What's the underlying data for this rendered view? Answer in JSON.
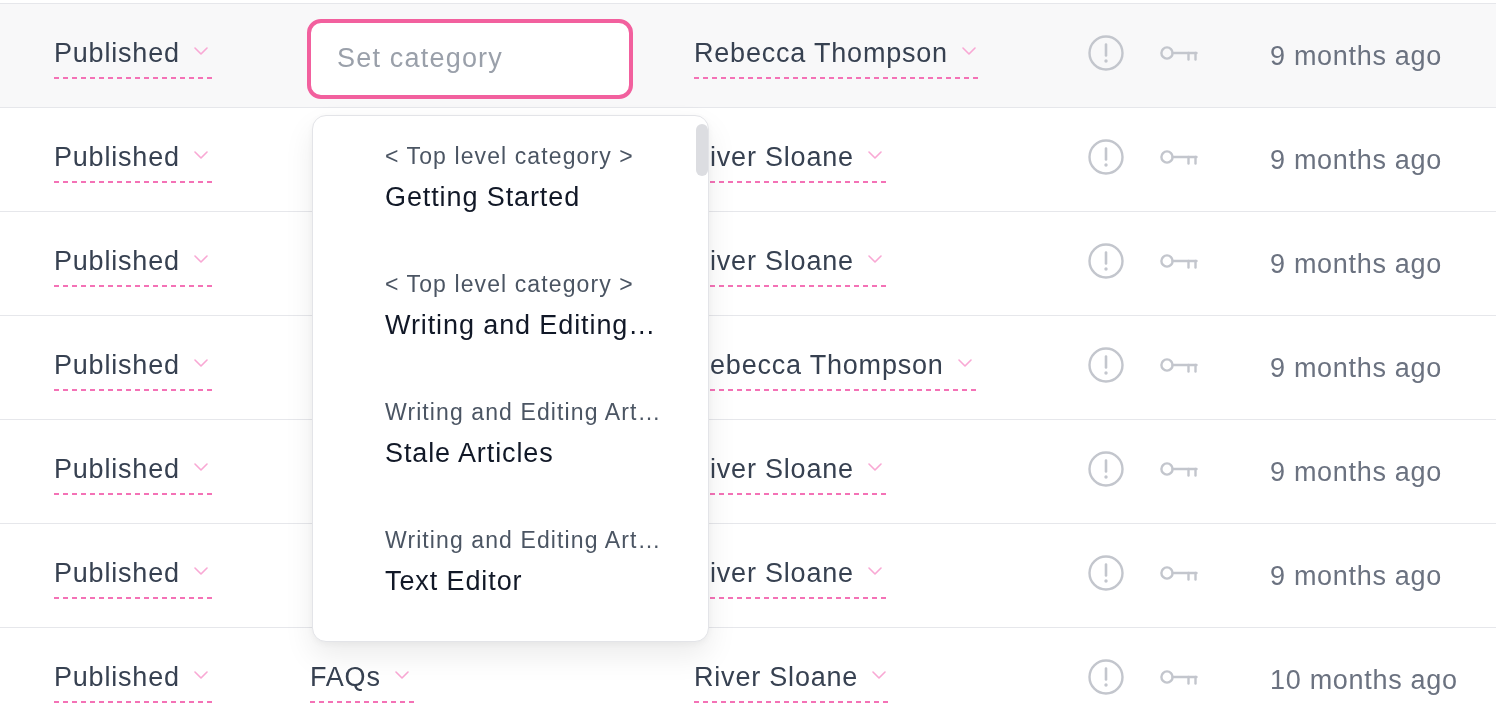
{
  "rows": [
    {
      "status": "Published",
      "category": {
        "kind": "input",
        "placeholder": "Set category"
      },
      "author": "Rebecca Thompson",
      "time": "9 months ago"
    },
    {
      "status": "Published",
      "author": "iver Sloane",
      "time": "9 months ago"
    },
    {
      "status": "Published",
      "author": "iver Sloane",
      "time": "9 months ago"
    },
    {
      "status": "Published",
      "author": "ebecca Thompson",
      "time": "9 months ago"
    },
    {
      "status": "Published",
      "author": "iver Sloane",
      "time": "9 months ago"
    },
    {
      "status": "Published",
      "author": "iver Sloane",
      "time": "9 months ago"
    },
    {
      "status": "Published",
      "category": {
        "kind": "select",
        "value": "FAQs"
      },
      "author": "River Sloane",
      "time": "10 months ago"
    }
  ],
  "category_menu": {
    "options": [
      {
        "path": "< Top level category >",
        "name": "Getting Started",
        "selected": false
      },
      {
        "path": "< Top level category >",
        "name": "Writing and Editing…",
        "selected": false
      },
      {
        "path": "Writing and Editing Art…",
        "name": "Stale Articles",
        "selected": false
      },
      {
        "path": "Writing and Editing Art…",
        "name": "Text Editor",
        "selected": false
      }
    ]
  }
}
